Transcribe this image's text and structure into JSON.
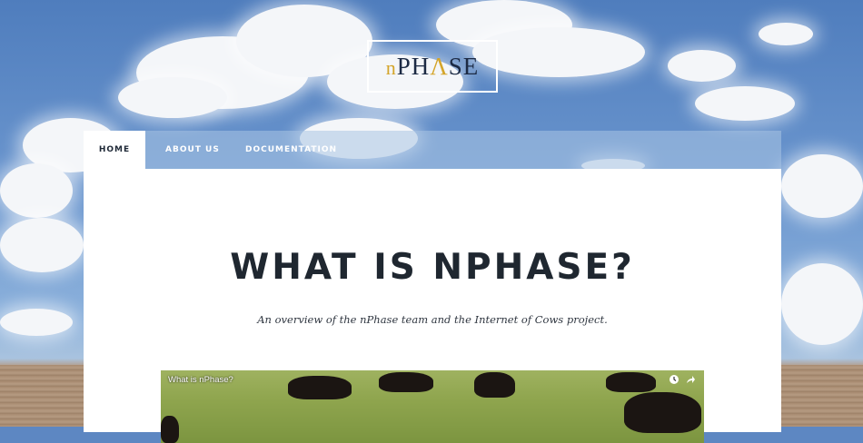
{
  "header": {
    "logo": {
      "prefix": "n",
      "main": "PH",
      "accent": "Λ",
      "suffix": "SE"
    }
  },
  "nav": {
    "items": [
      {
        "label": "HOME",
        "active": true
      },
      {
        "label": "ABOUT US",
        "active": false
      },
      {
        "label": "DOCUMENTATION",
        "active": false
      }
    ]
  },
  "main": {
    "title": "WHAT IS NPHASE?",
    "subtitle": "An overview of the nPhase team and the Internet of Cows project.",
    "video": {
      "title": "What is nPhase?",
      "icons": [
        "clock-icon",
        "share-icon"
      ]
    }
  },
  "colors": {
    "accent": "#d4a52a",
    "logo_text": "#1c2a44",
    "heading": "#1f2730",
    "sky": "#5d87c2"
  }
}
